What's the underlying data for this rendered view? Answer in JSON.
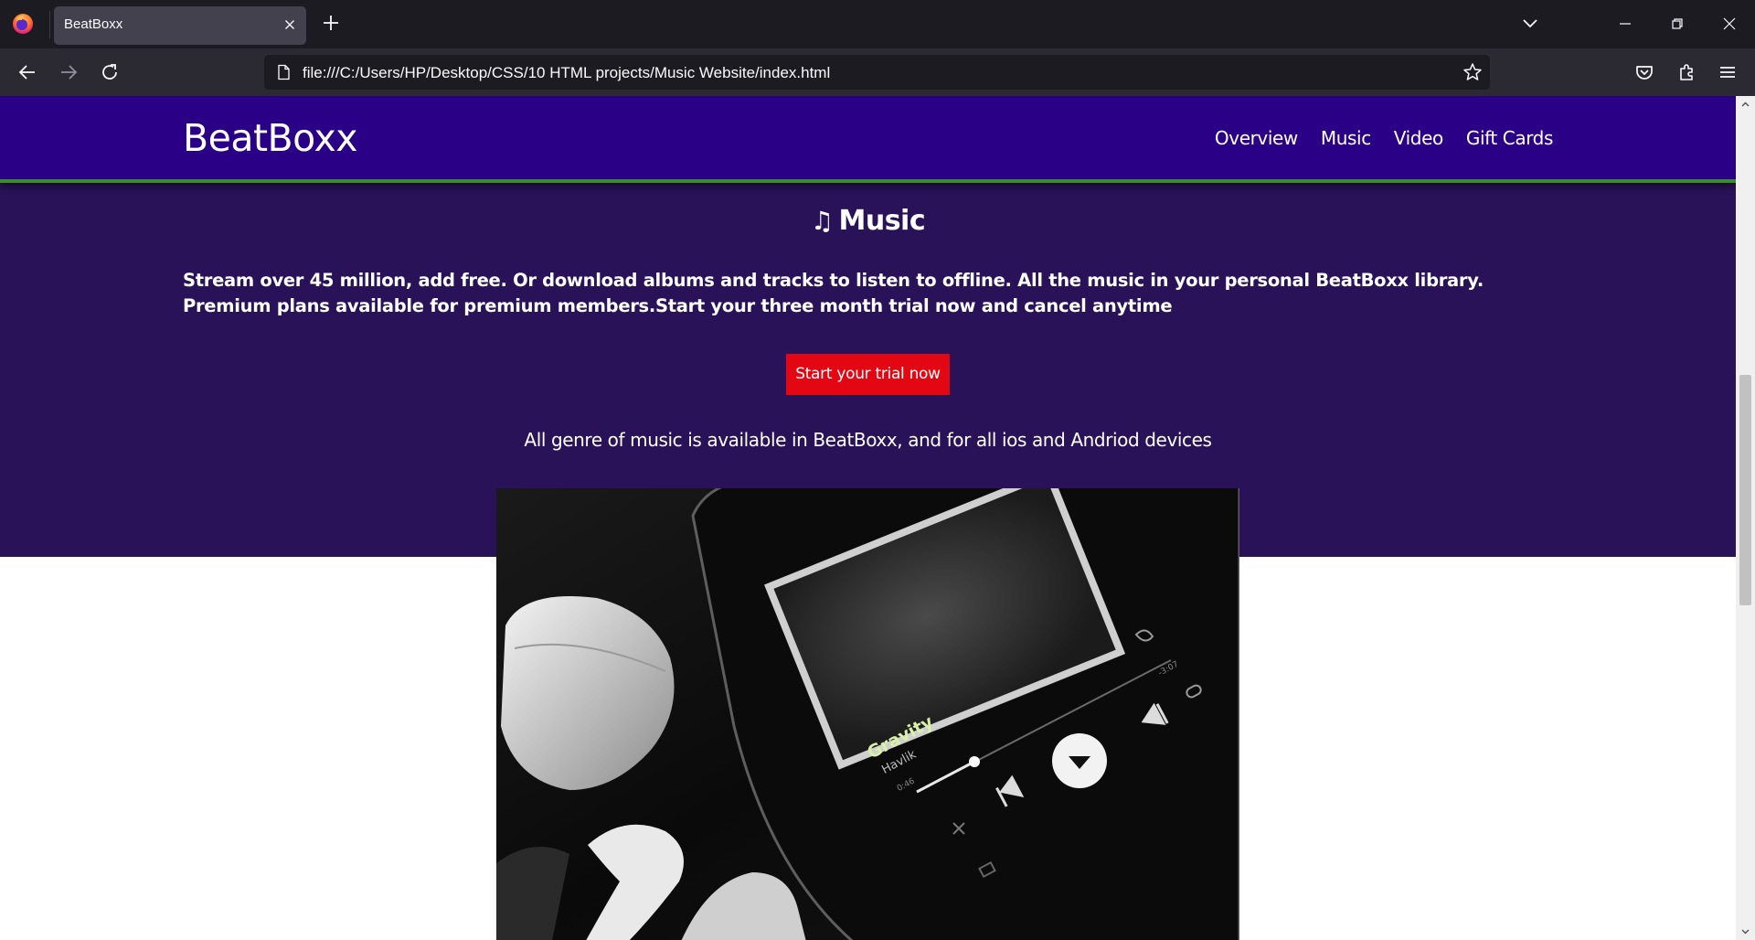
{
  "browser": {
    "tab_title": "BeatBoxx",
    "url": "file:///C:/Users/HP/Desktop/CSS/10 HTML projects/Music Website/index.html"
  },
  "site": {
    "brand": "BeatBoxx",
    "nav": [
      "Overview",
      "Music",
      "Video",
      "Gift Cards"
    ],
    "colors": {
      "header": "#2a0086",
      "header_border": "#3a8c2e",
      "section": "#2a1258",
      "button": "#e30613"
    }
  },
  "music": {
    "title_icon": "♫",
    "title": "Music",
    "description": "Stream over 45 million, add free. Or download albums and tracks to listen to offline. All the music in your personal BeatBoxx library. Premium plans available for premium members.Start your three month trial now and cancel anytime",
    "cta_label": "Start your trial now",
    "genre_text": "All genre of music is available in BeatBoxx, and for all ios and Andriod devices"
  },
  "photo": {
    "song_title": "Gravity",
    "artist": "Havlik",
    "elapsed": "0:46",
    "remaining": "-3:07"
  }
}
